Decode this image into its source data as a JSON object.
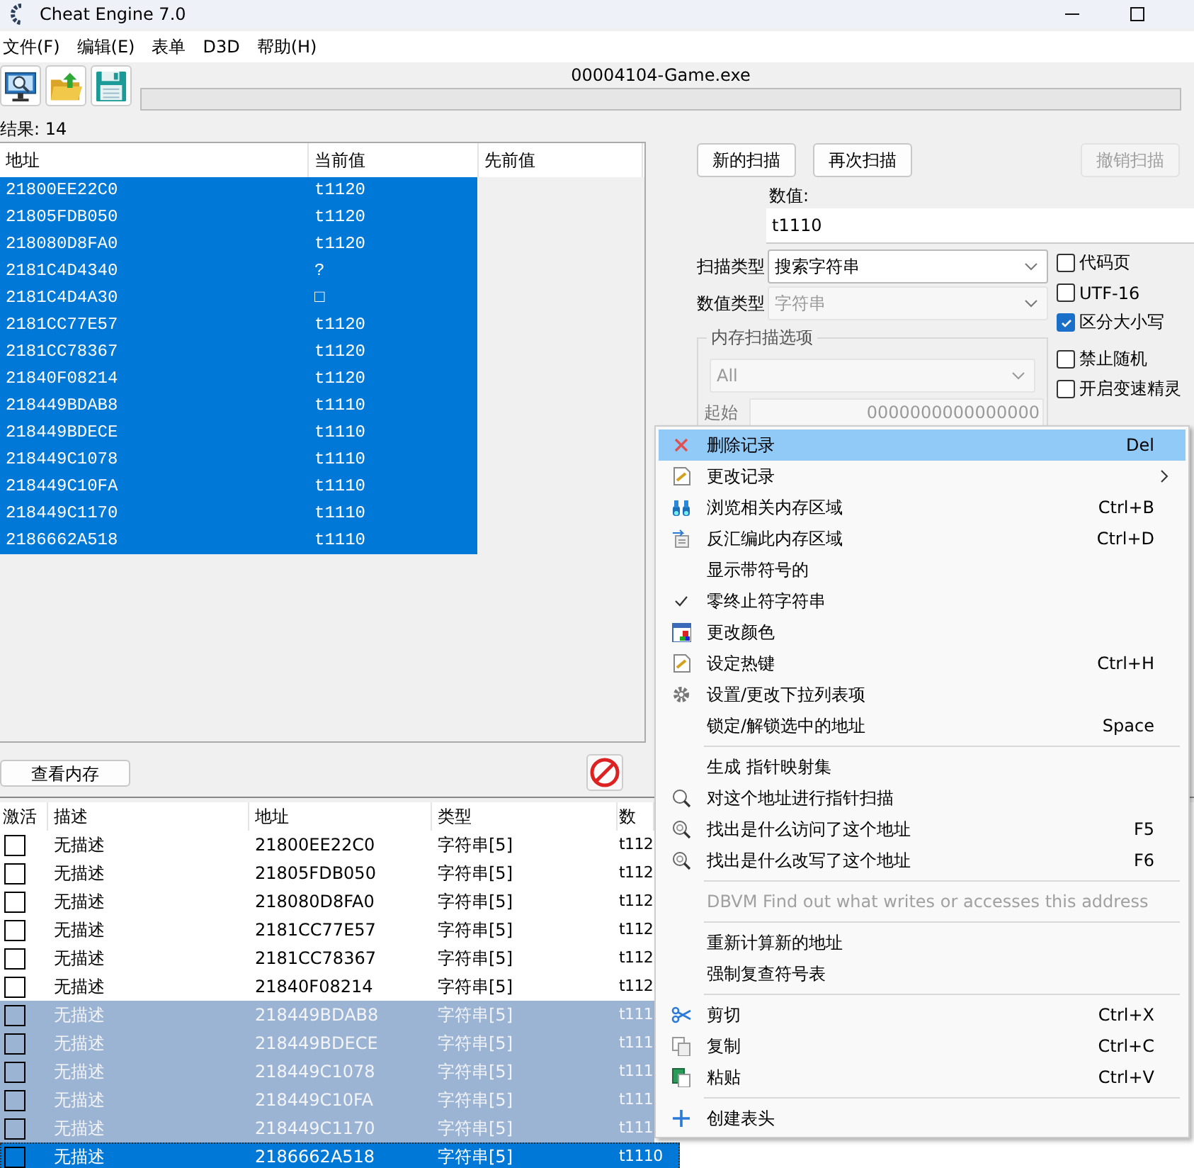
{
  "window": {
    "title": "Cheat Engine 7.0"
  },
  "menu_bar": [
    "文件(F)",
    "编辑(E)",
    "表单",
    "D3D",
    "帮助(H)"
  ],
  "process": {
    "name": "00004104-Game.exe",
    "level": 0
  },
  "results_label": "结果: 14",
  "scan_results": {
    "columns": [
      "地址",
      "当前值",
      "先前值"
    ],
    "rows": [
      {
        "address": "21800EE22C0",
        "current": "t1120",
        "selected": true
      },
      {
        "address": "21805FDB050",
        "current": "t1120",
        "selected": true
      },
      {
        "address": "218080D8FA0",
        "current": "t1120",
        "selected": true
      },
      {
        "address": "2181C4D4340",
        "current": "?",
        "selected": true
      },
      {
        "address": "2181C4D4A30",
        "current": "□",
        "selected": true
      },
      {
        "address": "2181CC77E57",
        "current": "t1120",
        "selected": true
      },
      {
        "address": "2181CC78367",
        "current": "t1120",
        "selected": true
      },
      {
        "address": "21840F08214",
        "current": "t1120",
        "selected": true
      },
      {
        "address": "218449BDAB8",
        "current": "t1110",
        "selected": true
      },
      {
        "address": "218449BDECE",
        "current": "t1110",
        "selected": true
      },
      {
        "address": "218449C1078",
        "current": "t1110",
        "selected": true
      },
      {
        "address": "218449C10FA",
        "current": "t1110",
        "selected": true
      },
      {
        "address": "218449C1170",
        "current": "t1110",
        "selected": true
      },
      {
        "address": "2186662A518",
        "current": "t1110",
        "selected": true
      }
    ]
  },
  "scan_buttons": [
    {
      "label": "新的扫描",
      "disabled": false
    },
    {
      "label": "再次扫描",
      "disabled": false
    },
    {
      "label": "撤销扫描",
      "disabled": true
    }
  ],
  "value": {
    "label": "数值:",
    "value": "t1110"
  },
  "scan_type": {
    "label": "扫描类型",
    "value": "搜索字符串",
    "disabled": false
  },
  "value_type": {
    "label": "数值类型",
    "value": "字符串",
    "disabled": true
  },
  "options": [
    {
      "label": "代码页",
      "checked": false
    },
    {
      "label": "UTF-16",
      "checked": false
    },
    {
      "label": "区分大小写",
      "checked": true
    },
    {
      "label": "禁止随机",
      "checked": false
    },
    {
      "label": "开启变速精灵",
      "checked": false
    }
  ],
  "memory_options": {
    "title": "内存扫描选项",
    "region": "All",
    "start_label": "起始",
    "start": "0000000000000000"
  },
  "view_memory_button": "查看内存",
  "address_list": {
    "columns": [
      "激活",
      "描述",
      "地址",
      "类型",
      "数"
    ],
    "rows": [
      {
        "active": false,
        "description": "无描述",
        "address": "21800EE22C0",
        "type": "字符串[5]",
        "value": "t112",
        "selected": false,
        "focused": false
      },
      {
        "active": false,
        "description": "无描述",
        "address": "21805FDB050",
        "type": "字符串[5]",
        "value": "t112",
        "selected": false,
        "focused": false
      },
      {
        "active": false,
        "description": "无描述",
        "address": "218080D8FA0",
        "type": "字符串[5]",
        "value": "t112",
        "selected": false,
        "focused": false
      },
      {
        "active": false,
        "description": "无描述",
        "address": "2181CC77E57",
        "type": "字符串[5]",
        "value": "t112",
        "selected": false,
        "focused": false
      },
      {
        "active": false,
        "description": "无描述",
        "address": "2181CC78367",
        "type": "字符串[5]",
        "value": "t112",
        "selected": false,
        "focused": false
      },
      {
        "active": false,
        "description": "无描述",
        "address": "21840F08214",
        "type": "字符串[5]",
        "value": "t112",
        "selected": false,
        "focused": false
      },
      {
        "active": false,
        "description": "无描述",
        "address": "218449BDAB8",
        "type": "字符串[5]",
        "value": "t111",
        "selected": true,
        "focused": false
      },
      {
        "active": false,
        "description": "无描述",
        "address": "218449BDECE",
        "type": "字符串[5]",
        "value": "t111",
        "selected": true,
        "focused": false
      },
      {
        "active": false,
        "description": "无描述",
        "address": "218449C1078",
        "type": "字符串[5]",
        "value": "t111",
        "selected": true,
        "focused": false
      },
      {
        "active": false,
        "description": "无描述",
        "address": "218449C10FA",
        "type": "字符串[5]",
        "value": "t111",
        "selected": true,
        "focused": false
      },
      {
        "active": false,
        "description": "无描述",
        "address": "218449C1170",
        "type": "字符串[5]",
        "value": "t111",
        "selected": true,
        "focused": false
      },
      {
        "active": false,
        "description": "无描述",
        "address": "2186662A518",
        "type": "字符串[5]",
        "value": "t1110",
        "selected": true,
        "focused": true
      }
    ]
  },
  "context_menu": [
    {
      "kind": "item",
      "label": "删除记录",
      "shortcut": "Del",
      "selected": true
    },
    {
      "kind": "item",
      "label": "更改记录",
      "submenu": true,
      "selected": false
    },
    {
      "kind": "item",
      "label": "浏览相关内存区域",
      "shortcut": "Ctrl+B",
      "selected": false
    },
    {
      "kind": "item",
      "label": "反汇编此内存区域",
      "shortcut": "Ctrl+D",
      "selected": false
    },
    {
      "kind": "item",
      "label": "显示带符号的",
      "selected": false
    },
    {
      "kind": "item",
      "label": "零终止符字符串",
      "checked": true,
      "selected": false
    },
    {
      "kind": "item",
      "label": "更改颜色",
      "selected": false
    },
    {
      "kind": "item",
      "label": "设定热键",
      "shortcut": "Ctrl+H",
      "selected": false
    },
    {
      "kind": "item",
      "label": "设置/更改下拉列表项",
      "selected": false
    },
    {
      "kind": "item",
      "label": "锁定/解锁选中的地址",
      "shortcut": "Space",
      "selected": false
    },
    {
      "kind": "separator"
    },
    {
      "kind": "item",
      "label": "生成 指针映射集",
      "selected": false
    },
    {
      "kind": "item",
      "label": "对这个地址进行指针扫描",
      "selected": false
    },
    {
      "kind": "item",
      "label": "找出是什么访问了这个地址",
      "shortcut": "F5",
      "selected": false
    },
    {
      "kind": "item",
      "label": "找出是什么改写了这个地址",
      "shortcut": "F6",
      "selected": false
    },
    {
      "kind": "separator"
    },
    {
      "kind": "item",
      "label": "DBVM Find out what writes or accesses this address",
      "disabled": true,
      "selected": false
    },
    {
      "kind": "separator"
    },
    {
      "kind": "item",
      "label": "重新计算新的地址",
      "selected": false
    },
    {
      "kind": "item",
      "label": "强制复查符号表",
      "selected": false
    },
    {
      "kind": "separator"
    },
    {
      "kind": "item",
      "label": "剪切",
      "shortcut": "Ctrl+X",
      "selected": false
    },
    {
      "kind": "item",
      "label": "复制",
      "shortcut": "Ctrl+C",
      "selected": false
    },
    {
      "kind": "item",
      "label": "粘贴",
      "shortcut": "Ctrl+V",
      "selected": false
    },
    {
      "kind": "separator"
    },
    {
      "kind": "item",
      "label": "创建表头",
      "selected": false
    }
  ]
}
